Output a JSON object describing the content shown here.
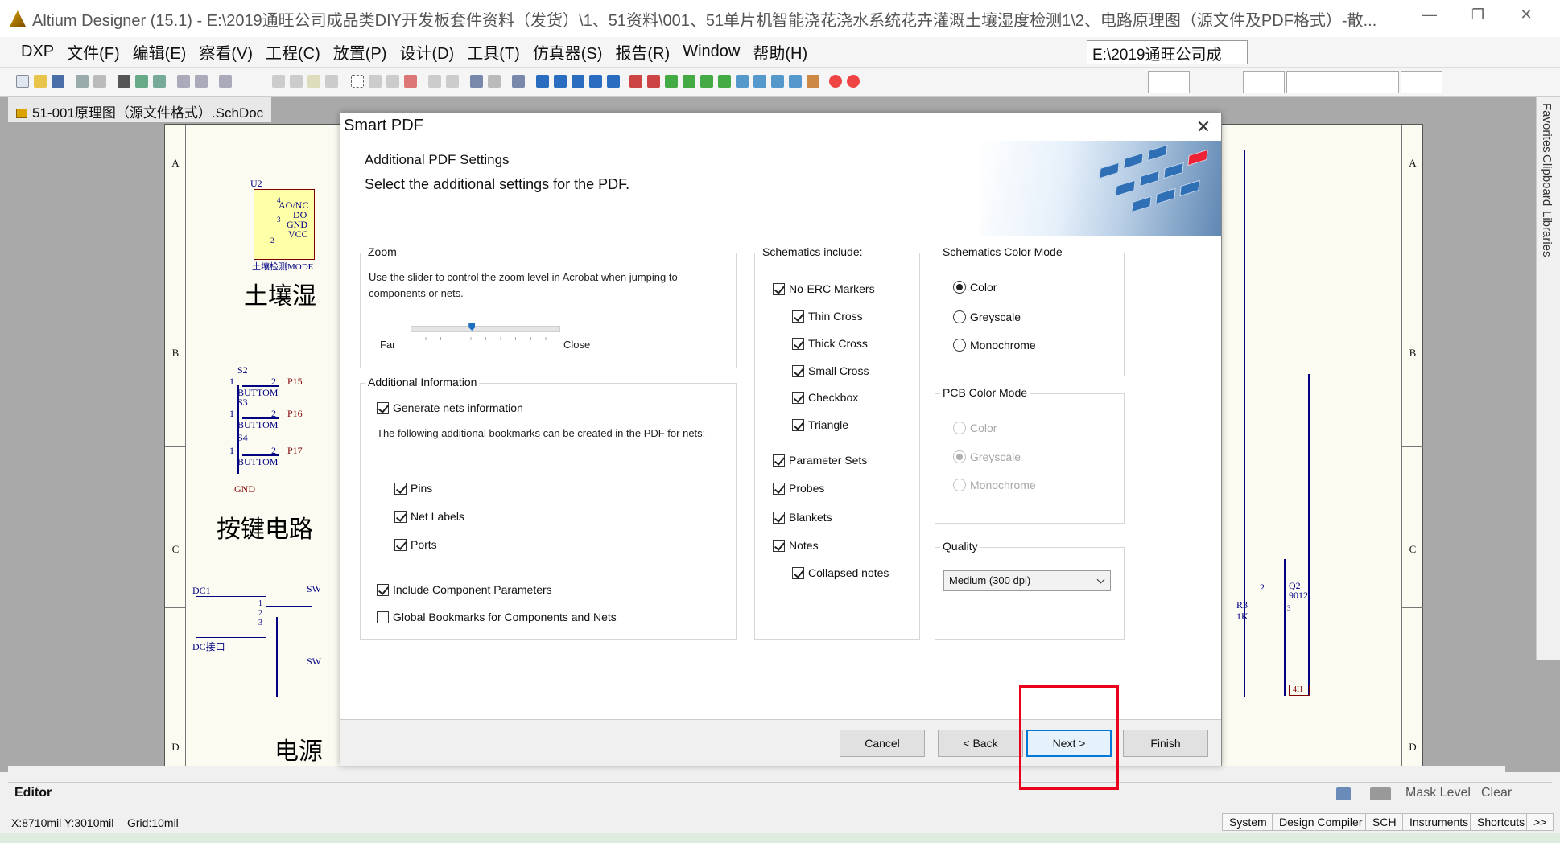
{
  "window": {
    "title": "Altium Designer (15.1) - E:\\2019通旺公司成品类DIY开发板套件资料（发货）\\1、51资料\\001、51单片机智能浇花浇水系统花卉灌溉土壤湿度检测1\\2、电路原理图（源文件及PDF格式）-散...",
    "minimize": "—",
    "restore": "❐",
    "close": "✕"
  },
  "menu": {
    "items": [
      "DXP",
      "文件(F)",
      "编辑(E)",
      "察看(V)",
      "工程(C)",
      "放置(P)",
      "设计(D)",
      "工具(T)",
      "仿真器(S)",
      "报告(R)",
      "Window",
      "帮助(H)"
    ],
    "path_combo": "E:\\2019通旺公司成"
  },
  "doc_tab": "51-001原理图（源文件格式）.SchDoc",
  "sheet": {
    "zones_left": [
      "A",
      "B",
      "C",
      "D"
    ],
    "zones_right": [
      "A",
      "B",
      "C",
      "D"
    ],
    "u2": "U2",
    "u2_pins": [
      "AO/NC",
      "DO",
      "GND",
      "VCC"
    ],
    "u2_pin_numbers": [
      "4",
      "3",
      "2",
      "1"
    ],
    "u2_label": "土壤检测MODE",
    "soil_heading": "土壤湿",
    "s2": "S2",
    "s3": "S3",
    "s4": "S4",
    "button": "BUTTOM",
    "p15": "P15",
    "p16": "P16",
    "p17": "P17",
    "pin1": "1",
    "pin2": "2",
    "gnd": "GND",
    "key_heading": "按键电路",
    "dc1": "DC1",
    "dc_label": "DC接口",
    "dc_pins": [
      "1",
      "2",
      "3"
    ],
    "sw": "SW",
    "power_heading": "电源",
    "r3": "R3",
    "r3_val": "1K",
    "q2": "Q2",
    "q2_type": "9012",
    "q2_pins": [
      "2",
      "3"
    ],
    "h4": "4H"
  },
  "right_panel": [
    "Favorites",
    "Clipboard",
    "Libraries"
  ],
  "editor_bar": {
    "label": "Editor",
    "mask_level": "Mask Level",
    "clear": "Clear"
  },
  "statusbar": {
    "coords": "X:8710mil Y:3010mil",
    "grid": "Grid:10mil",
    "tabs": [
      "System",
      "Design Compiler",
      "SCH",
      "Instruments",
      "Shortcuts",
      ">>"
    ]
  },
  "dialog": {
    "title": "Smart PDF",
    "close": "✕",
    "header_title": "Additional PDF Settings",
    "header_sub": "Select the additional settings for the PDF.",
    "zoom": {
      "title": "Zoom",
      "desc": "Use the slider to control the zoom level in Acrobat when jumping to components or nets.",
      "far": "Far",
      "close": "Close",
      "level": 0.41
    },
    "additional": {
      "title": "Additional Information",
      "generate_nets": {
        "label": "Generate nets information",
        "checked": true
      },
      "bookmarks_desc": "The following additional bookmarks can be created in the PDF for nets:",
      "pins": {
        "label": "Pins",
        "checked": true
      },
      "net_labels": {
        "label": "Net Labels",
        "checked": true
      },
      "ports": {
        "label": "Ports",
        "checked": true
      },
      "include_params": {
        "label": "Include Component Parameters",
        "checked": true
      },
      "global_bookmarks": {
        "label": "Global Bookmarks for Components and Nets",
        "checked": false
      }
    },
    "schematics": {
      "title": "Schematics include:",
      "items": [
        {
          "label": "No-ERC Markers",
          "checked": true,
          "indent": 0
        },
        {
          "label": "Thin Cross",
          "checked": true,
          "indent": 1
        },
        {
          "label": "Thick Cross",
          "checked": true,
          "indent": 1
        },
        {
          "label": "Small Cross",
          "checked": true,
          "indent": 1
        },
        {
          "label": "Checkbox",
          "checked": true,
          "indent": 1
        },
        {
          "label": "Triangle",
          "checked": true,
          "indent": 1
        },
        {
          "label": "Parameter Sets",
          "checked": true,
          "indent": 0
        },
        {
          "label": "Probes",
          "checked": true,
          "indent": 0
        },
        {
          "label": "Blankets",
          "checked": true,
          "indent": 0
        },
        {
          "label": "Notes",
          "checked": true,
          "indent": 0
        },
        {
          "label": "Collapsed notes",
          "checked": true,
          "indent": 1
        }
      ]
    },
    "sch_color": {
      "title": "Schematics Color Mode",
      "options": [
        "Color",
        "Greyscale",
        "Monochrome"
      ],
      "selected": "Color"
    },
    "pcb_color": {
      "title": "PCB Color Mode",
      "options": [
        "Color",
        "Greyscale",
        "Monochrome"
      ],
      "selected": "Greyscale"
    },
    "quality": {
      "title": "Quality",
      "value": "Medium (300 dpi)"
    },
    "buttons": {
      "cancel": "Cancel",
      "back": "< Back",
      "next": "Next >",
      "finish": "Finish"
    }
  }
}
